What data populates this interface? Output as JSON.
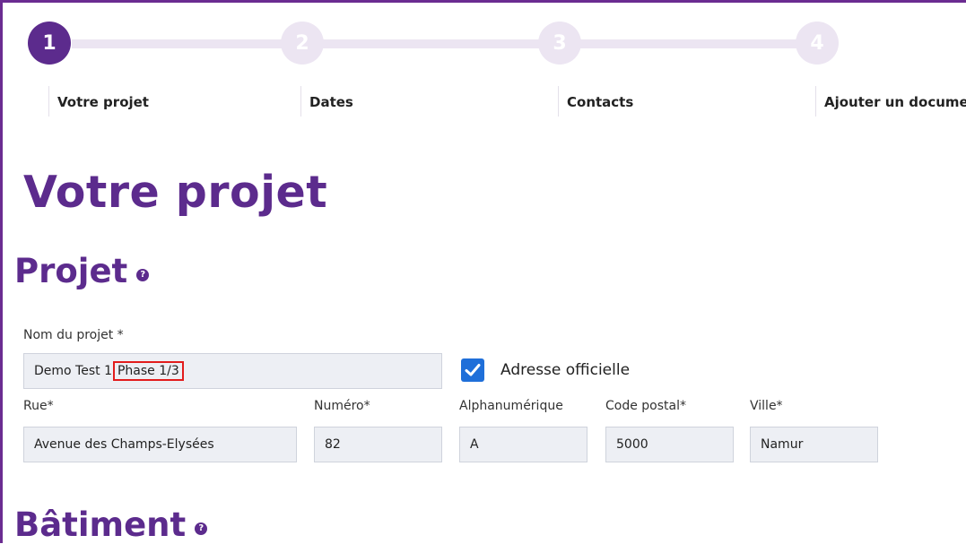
{
  "stepper": {
    "steps": [
      {
        "number": "1",
        "label": "Votre projet"
      },
      {
        "number": "2",
        "label": "Dates"
      },
      {
        "number": "3",
        "label": "Contacts"
      },
      {
        "number": "4",
        "label": "Ajouter un document"
      }
    ]
  },
  "page": {
    "title": "Votre projet",
    "section_projet": "Projet",
    "section_batiment": "Bâtiment",
    "help_glyph": "?"
  },
  "form": {
    "nom_projet_label": "Nom du projet *",
    "nom_projet_value_part1": "Demo Test 1",
    "nom_projet_value_part2": "Phase 1/3",
    "adresse_officielle_label": "Adresse officielle",
    "adresse_officielle_checked": true,
    "rue_label": "Rue*",
    "rue_value": "Avenue des Champs-Elysées",
    "numero_label": "Numéro*",
    "numero_value": "82",
    "alpha_label": "Alphanumérique",
    "alpha_value": "A",
    "code_postal_label": "Code postal*",
    "code_postal_value": "5000",
    "ville_label": "Ville*",
    "ville_value": "Namur"
  },
  "colors": {
    "brand": "#5c2b8d",
    "step_inactive": "#ece5f2",
    "checkbox": "#1f6fd9",
    "highlight": "#e21c1c"
  }
}
